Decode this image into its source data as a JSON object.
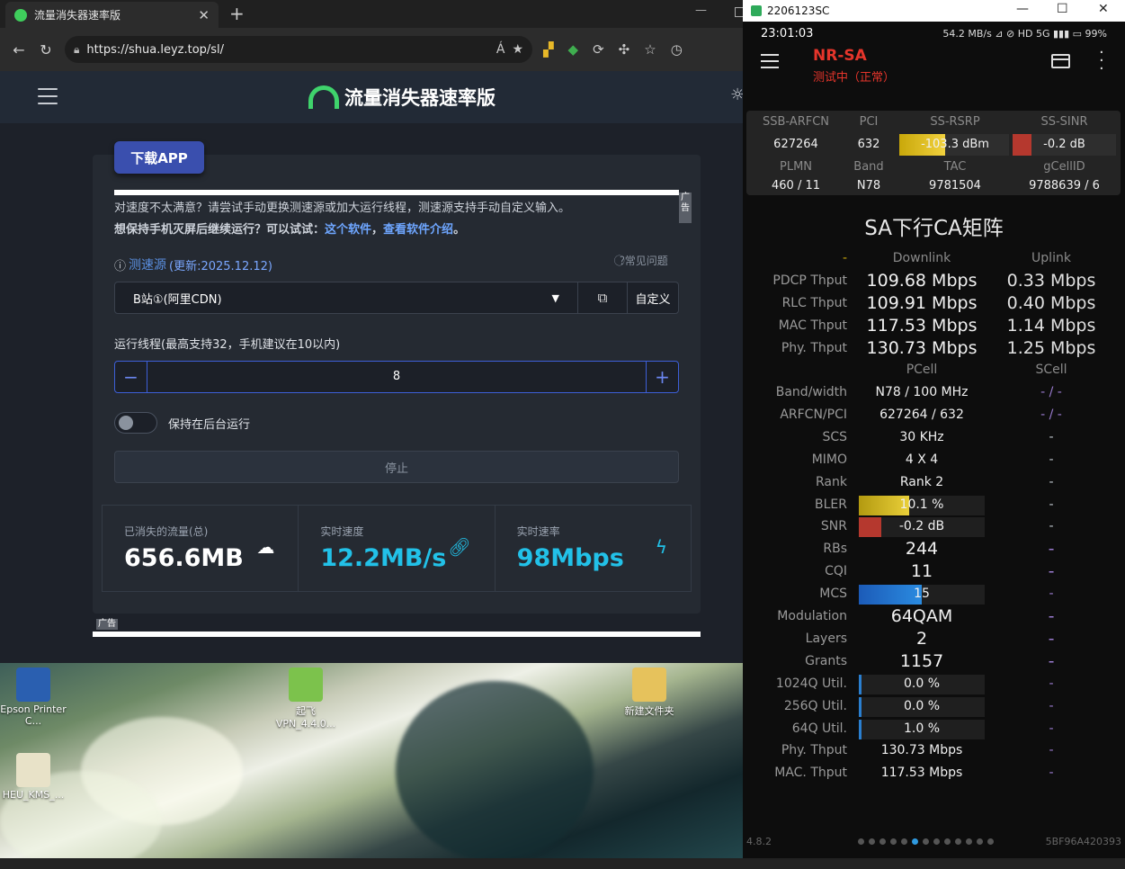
{
  "browser": {
    "tab_title": "流量消失器速率版",
    "url": "https://shua.leyz.top/sl/",
    "read_aloud": "Á"
  },
  "site": {
    "title": "流量消失器速率版",
    "download_app": "下载APP",
    "ad_label": "广告",
    "notice_line1": "对速度不太满意？请尝试手动更换测速源或加大运行线程，测速源支持手动自定义输入。",
    "notice_line2_prefix": "想保持手机灭屏后继续运行？可以试试：",
    "notice_link1": "这个软件",
    "notice_sep": "，",
    "notice_link2": "查看软件介绍",
    "notice_end": "。",
    "source_label": "测速源",
    "source_updated": "(更新:2025.12.12)",
    "source_paren_open": "(",
    "faq": "常见问题",
    "source_selected": "B站①(阿里CDN)",
    "custom_label": "自定义",
    "thread_label": "运行线程(最高支持32，手机建议在10以内)",
    "thread_value": "8",
    "bg_run_label": "保持在后台运行",
    "stop_label": "停止",
    "stats": [
      {
        "label": "已消失的流量(总)",
        "value": "656.6MB",
        "color": "#ffffff",
        "icon": "cloud-icon"
      },
      {
        "label": "实时速度",
        "value": "12.2MB/s",
        "color": "#22c1e8",
        "icon": "link-icon"
      },
      {
        "label": "实时速率",
        "value": "98Mbps",
        "color": "#22c1e8",
        "icon": "bolt-icon"
      }
    ]
  },
  "desktop": {
    "icons": [
      {
        "label": "Epson Printer C...",
        "icon": "printer-icon"
      },
      {
        "label": "起飞 VPN_4.4.0...",
        "icon": "app-icon"
      },
      {
        "label": "新建文件夹",
        "icon": "folder-icon"
      },
      {
        "label": "HEU_KMS_...",
        "icon": "file-icon"
      }
    ]
  },
  "phone": {
    "window_title": "2206123SC",
    "time": "23:01:03",
    "status_right": "54.2 MB/s ⊿ ⊘ HD 5G ▮▮▮ ▭ 99%",
    "net_type": "NR-SA",
    "state": "测试中（正常）",
    "cell_headers": [
      "SSB-ARFCN",
      "PCI",
      "SS-RSRP",
      "SS-SINR"
    ],
    "cell_values": [
      "627264",
      "632",
      "-103.3 dBm",
      "-0.2 dB"
    ],
    "cell_headers2": [
      "PLMN",
      "Band",
      "TAC",
      "gCellID"
    ],
    "cell_values2": [
      "460 / 11",
      "N78",
      "9781504",
      "9788639 / 6"
    ],
    "rsrp_fill": 0.42,
    "sinr_fill": 0.18,
    "ca_title": "SA下行CA矩阵",
    "col_dash": "-",
    "col_down": "Downlink",
    "col_up": "Uplink",
    "thput_rows": [
      {
        "label": "PDCP Thput",
        "down": "109.68 Mbps",
        "up": "0.33 Mbps"
      },
      {
        "label": "RLC Thput",
        "down": "109.91 Mbps",
        "up": "0.40 Mbps"
      },
      {
        "label": "MAC Thput",
        "down": "117.53 Mbps",
        "up": "1.14 Mbps"
      },
      {
        "label": "Phy. Thput",
        "down": "130.73 Mbps",
        "up": "1.25 Mbps"
      }
    ],
    "pcell": "PCell",
    "scell": "SCell",
    "rows": [
      {
        "label": "Band/width",
        "p": "N78 / 100 MHz",
        "s": "- / -"
      },
      {
        "label": "ARFCN/PCI",
        "p": "627264 / 632",
        "s": "- / -"
      },
      {
        "label": "SCS",
        "p": "30 KHz",
        "s": "-"
      },
      {
        "label": "MIMO",
        "p": "4 X 4",
        "s": "-"
      },
      {
        "label": "Rank",
        "p": "Rank 2",
        "s": "-"
      },
      {
        "label": "BLER",
        "p": "10.1 %",
        "s": "-"
      },
      {
        "label": "SNR",
        "p": "-0.2 dB",
        "s": "-"
      },
      {
        "label": "RBs",
        "p": "244",
        "s": "-"
      },
      {
        "label": "CQI",
        "p": "11",
        "s": "-"
      },
      {
        "label": "MCS",
        "p": "15",
        "s": "-"
      },
      {
        "label": "Modulation",
        "p": "64QAM",
        "s": "-"
      },
      {
        "label": "Layers",
        "p": "2",
        "s": "-"
      },
      {
        "label": "Grants",
        "p": "1157",
        "s": "-"
      },
      {
        "label": "1024Q Util.",
        "p": "0.0 %",
        "s": "-"
      },
      {
        "label": "256Q Util.",
        "p": "0.0 %",
        "s": "-"
      },
      {
        "label": "64Q Util.",
        "p": "1.0 %",
        "s": "-"
      },
      {
        "label": "Phy. Thput",
        "p": "130.73 Mbps",
        "s": "-"
      },
      {
        "label": "MAC. Thput",
        "p": "117.53 Mbps",
        "s": "-"
      }
    ],
    "bler_fill": 0.4,
    "snr_fill": 0.18,
    "mcs_fill": 0.5,
    "util_fill": 0.02,
    "version": "4.8.2",
    "device_id": "5BF96A420393"
  }
}
